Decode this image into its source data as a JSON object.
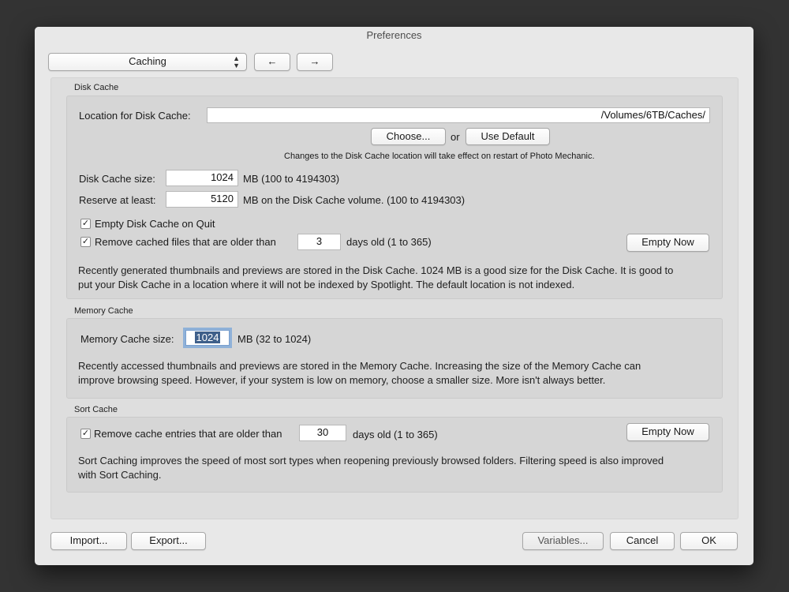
{
  "window": {
    "title": "Preferences"
  },
  "toolbar": {
    "category": "Caching",
    "back_glyph": "←",
    "forward_glyph": "→"
  },
  "disk_cache": {
    "group_title": "Disk Cache",
    "location_label": "Location for Disk Cache:",
    "location_value": "/Volumes/6TB/Caches/",
    "choose_label": "Choose...",
    "or_text": "or",
    "use_default_label": "Use Default",
    "restart_note": "Changes to the Disk Cache location will take effect on restart of Photo Mechanic.",
    "size_label": "Disk Cache size:",
    "size_value": "1024",
    "size_unit": "MB (100 to 4194303)",
    "reserve_label": "Reserve at least:",
    "reserve_value": "5120",
    "reserve_unit": "MB on the Disk Cache volume. (100 to 4194303)",
    "empty_on_quit_label": "Empty Disk Cache on Quit",
    "empty_on_quit_checked": true,
    "remove_older_label": "Remove cached files that are older than",
    "remove_older_checked": true,
    "remove_older_days": "3",
    "days_text": "days old (1 to 365)",
    "empty_now_label": "Empty Now",
    "description_line1": "Recently generated thumbnails and previews are stored in the Disk Cache.  1024 MB is a good size for the Disk Cache.  It is good to",
    "description_line2": "put your Disk Cache in a location where it will not be indexed by Spotlight.  The default location is not indexed."
  },
  "memory_cache": {
    "group_title": "Memory Cache",
    "size_label": "Memory Cache size:",
    "size_value": "1024",
    "size_unit": "MB (32 to 1024)",
    "description_line1": "Recently accessed thumbnails and previews are stored in the Memory Cache.  Increasing the size of the Memory Cache can",
    "description_line2": "improve browsing speed.  However, if your system is low on memory, choose a smaller size.  More isn't always better."
  },
  "sort_cache": {
    "group_title": "Sort Cache",
    "remove_older_label": "Remove cache entries that are older than",
    "remove_older_checked": true,
    "remove_older_days": "30",
    "days_text": "days old (1 to 365)",
    "empty_now_label": "Empty Now",
    "description_line1": "Sort Caching improves the speed of most sort types when reopening previously browsed folders.  Filtering speed is also improved",
    "description_line2": "with Sort Caching."
  },
  "footer": {
    "import_label": "Import...",
    "export_label": "Export...",
    "variables_label": "Variables...",
    "cancel_label": "Cancel",
    "ok_label": "OK"
  },
  "icons": {
    "check": "check-icon",
    "popup_arrows": "up-down-chevron-icon"
  },
  "colors": {
    "background": "#333333",
    "window": "#e8e8e8",
    "selection": "#3e5f8a",
    "focus_ring": "#8fb1d8"
  }
}
